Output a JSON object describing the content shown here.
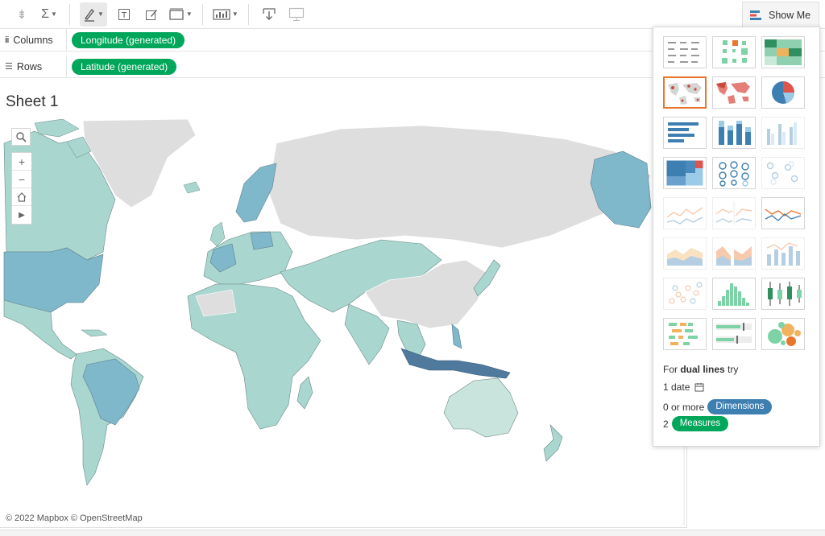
{
  "toolbar": {
    "buttons": [
      {
        "name": "sort-descending",
        "glyph": "⇟"
      },
      {
        "name": "totals",
        "glyph": "Σ"
      },
      {
        "name": "highlight",
        "glyph": "✎"
      },
      {
        "name": "text-label",
        "glyph": "T"
      },
      {
        "name": "annotate",
        "glyph": "✐"
      },
      {
        "name": "fit",
        "glyph": "▭"
      },
      {
        "name": "show-cards",
        "glyph": "▥"
      },
      {
        "name": "download",
        "glyph": "⤓"
      },
      {
        "name": "presentation",
        "glyph": "▢"
      }
    ],
    "show_me_label": "Show Me"
  },
  "shelves": {
    "columns": {
      "label": "Columns",
      "pill": "Longitude (generated)"
    },
    "rows": {
      "label": "Rows",
      "pill": "Latitude (generated)"
    }
  },
  "sheet": {
    "title": "Sheet 1",
    "attribution": "© 2022 Mapbox  © OpenStreetMap"
  },
  "map_tools": [
    "search-icon",
    "zoom-in-icon",
    "zoom-out-icon",
    "home-icon",
    "play-icon"
  ],
  "show_me": {
    "hint_prefix": "For ",
    "hint_bold": "dual lines",
    "hint_suffix": " try",
    "req_date": "1 date",
    "req_dimensions_prefix": "0 or more",
    "dimensions_label": "Dimensions",
    "req_measures_prefix": "2",
    "measures_label": "Measures",
    "selected_chart": "symbol-map",
    "colors": {
      "accent_green": "#00a65a",
      "accent_blue": "#3e7fb1",
      "selected_border": "#e8762d"
    },
    "chart_types": [
      "text-table",
      "heat-map",
      "highlight-table",
      "symbol-map",
      "filled-map",
      "pie-chart",
      "horizontal-bars",
      "stacked-bars",
      "side-by-side-bars",
      "treemap",
      "circle-views",
      "side-by-side-circles",
      "continuous-lines",
      "discrete-lines",
      "dual-lines",
      "area-continuous",
      "area-discrete",
      "dual-combination",
      "scatter-plot",
      "histogram",
      "box-and-whisker",
      "gantt-chart",
      "bullet-graph",
      "packed-bubbles"
    ]
  }
}
